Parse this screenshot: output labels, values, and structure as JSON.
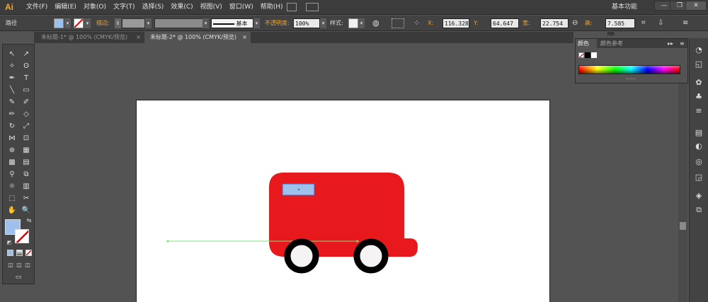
{
  "app": {
    "logo": "Ai",
    "workspace": "基本功能"
  },
  "menus": [
    "文件(F)",
    "编辑(E)",
    "对象(O)",
    "文字(T)",
    "选择(S)",
    "效果(C)",
    "视图(V)",
    "窗口(W)",
    "帮助(H)"
  ],
  "window_buttons": {
    "minimize": "—",
    "maximize": "❐",
    "close": "✕"
  },
  "control_bar": {
    "selection_label": "路径",
    "stroke_label": "描边:",
    "brush_label": "基本",
    "opacity_label": "不透明度:",
    "opacity_value": "100%",
    "style_label": "样式:",
    "x_label": "X:",
    "x_value": "116.328",
    "y_label": "Y:",
    "y_value": "64.647 m",
    "w_label": "宽:",
    "w_value": "22.754 m",
    "h_label": "高:",
    "h_value": "7.585 mm",
    "fill_color": "#9dc1ea"
  },
  "tabs": [
    {
      "label": "未标题-1* @ 100% (CMYK/预览)",
      "close": "×",
      "active": false
    },
    {
      "label": "未标题-2* @ 100% (CMYK/预览)",
      "close": "×",
      "active": true
    }
  ],
  "toolbox": {
    "tools": [
      [
        "selection-tool",
        "↖"
      ],
      [
        "direct-selection-tool",
        "↗"
      ],
      [
        "magic-wand-tool",
        "✧"
      ],
      [
        "lasso-tool",
        "ʘ"
      ],
      [
        "pen-tool",
        "✒"
      ],
      [
        "type-tool",
        "T"
      ],
      [
        "line-tool",
        "╲"
      ],
      [
        "rectangle-tool",
        "▭"
      ],
      [
        "paintbrush-tool",
        "✎"
      ],
      [
        "pencil-tool",
        "✐"
      ],
      [
        "blob-brush-tool",
        "✏"
      ],
      [
        "eraser-tool",
        "◇"
      ],
      [
        "rotate-tool",
        "↻"
      ],
      [
        "scale-tool",
        "⤢"
      ],
      [
        "width-tool",
        "⋈"
      ],
      [
        "free-transform-tool",
        "⊡"
      ],
      [
        "shape-builder-tool",
        "⊕"
      ],
      [
        "perspective-grid-tool",
        "▦"
      ],
      [
        "mesh-tool",
        "▩"
      ],
      [
        "gradient-tool",
        "▤"
      ],
      [
        "eyedropper-tool",
        "⚲"
      ],
      [
        "blend-tool",
        "⧉"
      ],
      [
        "symbol-sprayer-tool",
        "☼"
      ],
      [
        "column-graph-tool",
        "▥"
      ],
      [
        "artboard-tool",
        "⬚"
      ],
      [
        "slice-tool",
        "✂"
      ],
      [
        "hand-tool",
        "✋"
      ],
      [
        "zoom-tool",
        "🔍"
      ]
    ],
    "fill_color": "#9dc1ea"
  },
  "color_panel": {
    "tab_color": "颜色",
    "tab_guide": "颜色参考",
    "menu_glyph": "▸▸",
    "options_glyph": "≡"
  },
  "artwork": {
    "bus_color": "#e8191d",
    "window_color": "#9dc1ea",
    "wheel_color": "#000000",
    "hub_color": "#f5f3f3",
    "guide_color": "#7be07b"
  },
  "dock_icons": [
    "color-guide-icon",
    "swatches-icon",
    "brushes-icon",
    "symbols-icon",
    "stroke-icon",
    "gradient-icon",
    "transparency-icon",
    "appearance-icon",
    "graphic-styles-icon",
    "layers-icon",
    "artboards-icon"
  ]
}
